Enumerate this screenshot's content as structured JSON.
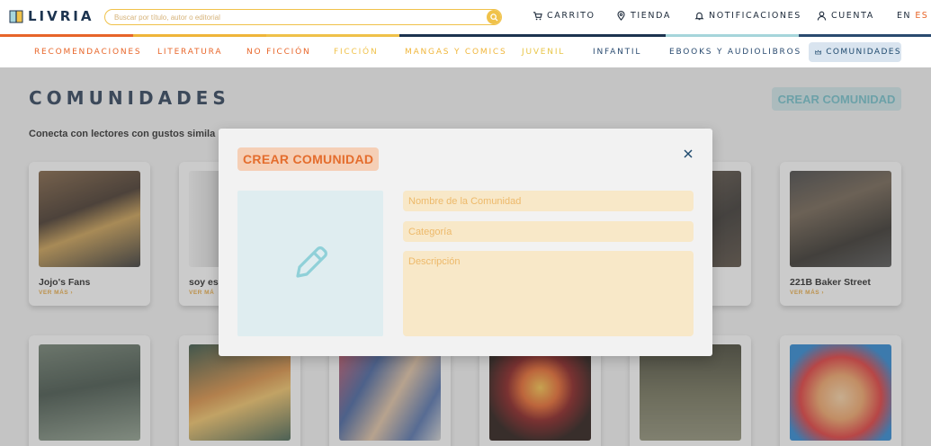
{
  "header": {
    "brand": "LIVRIA",
    "search_placeholder": "Buscar por título, autor o editorial",
    "nav": [
      {
        "label": "CARRITO",
        "icon": "cart-icon"
      },
      {
        "label": "TIENDA",
        "icon": "location-pin-icon"
      },
      {
        "label": "NOTIFICACIONES",
        "icon": "bell-icon"
      },
      {
        "label": "CUENTA",
        "icon": "user-icon"
      }
    ],
    "lang_en": "EN",
    "lang_es": "ES"
  },
  "colors": {
    "accent_orange": "#e8662a",
    "accent_yellow": "#f0c24a",
    "navy": "#1d3450",
    "teal": "#a7d6dc"
  },
  "categories": [
    {
      "label": "RECOMENDACIONES",
      "color": "#e8662a"
    },
    {
      "label": "LITERATURA",
      "color": "#e8662a"
    },
    {
      "label": "NO FICCIÓN",
      "color": "#e8662a"
    },
    {
      "label": "FICCIÓN",
      "color": "#f0c24a"
    },
    {
      "label": "MANGAS Y COMICS",
      "color": "#f0b63a"
    },
    {
      "label": "JUVENIL",
      "color": "#e8c547"
    },
    {
      "label": "INFANTIL",
      "color": "#2a4b70"
    },
    {
      "label": "EBOOKS Y AUDIOLIBROS",
      "color": "#2a4b70"
    },
    {
      "label": "COMUNIDADES",
      "color": "#1f4a6e",
      "active": true
    }
  ],
  "page": {
    "title": "COMUNIDADES",
    "subtitle": "Conecta con lectores con gustos simila",
    "create_button": "CREAR COMUNIDAD"
  },
  "communities": [
    {
      "name": "Jojo's Fans",
      "more": "VER MÁS ›"
    },
    {
      "name": "soy es",
      "more": "VER MÁ"
    },
    {
      "name": "",
      "more": ""
    },
    {
      "name": "",
      "more": ""
    },
    {
      "name": "",
      "more": ""
    },
    {
      "name": "221B Baker Street",
      "more": "VER MÁS ›"
    },
    {
      "name": "",
      "more": ""
    },
    {
      "name": "",
      "more": ""
    },
    {
      "name": "",
      "more": ""
    },
    {
      "name": "",
      "more": ""
    },
    {
      "name": "",
      "more": ""
    },
    {
      "name": "",
      "more": ""
    }
  ],
  "modal": {
    "title": "CREAR COMUNIDAD",
    "close_icon": "close-icon",
    "image_icon": "pencil-icon",
    "name_placeholder": "Nombre de la Comunidad",
    "category_placeholder": "Categoría",
    "description_placeholder": "Descripción"
  }
}
